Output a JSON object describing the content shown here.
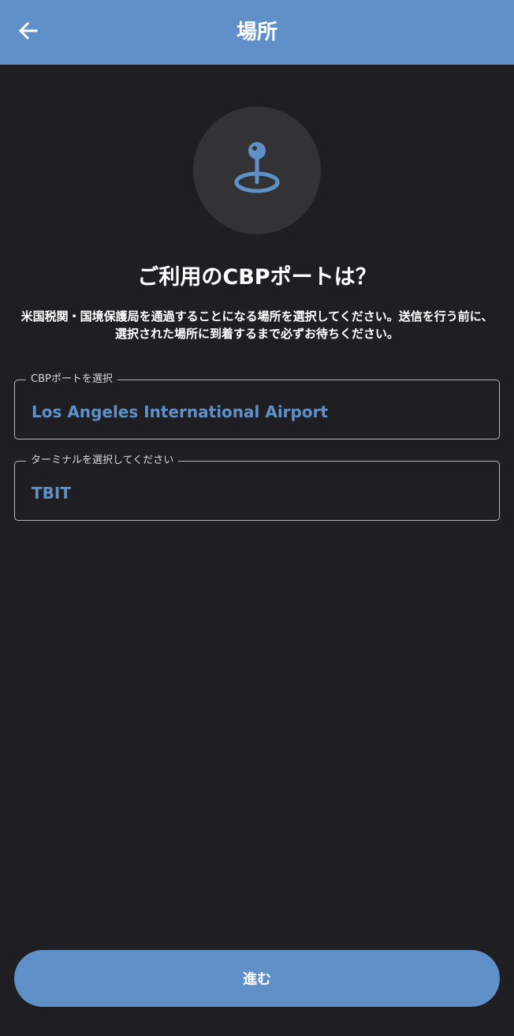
{
  "header": {
    "title": "場所",
    "back_icon": "arrow-left-icon"
  },
  "hero": {
    "icon": "location-pin-icon",
    "heading": "ご利用のCBPポートは？",
    "description": "米国税関・国境保護局を通過することになる場所を選択してください。送信を行う前に、選択された場所に到着するまで必ずお待ちください。"
  },
  "fields": {
    "port": {
      "label": "CBPポートを選択",
      "value": "Los Angeles International Airport"
    },
    "terminal": {
      "label": "ターミナルを選択してください",
      "value": "TBIT"
    }
  },
  "footer": {
    "continue_label": "進む"
  },
  "colors": {
    "accent": "#5f91c8",
    "background": "#1f1e22",
    "icon_circle": "#333335",
    "field_border": "#b8b8bc"
  }
}
